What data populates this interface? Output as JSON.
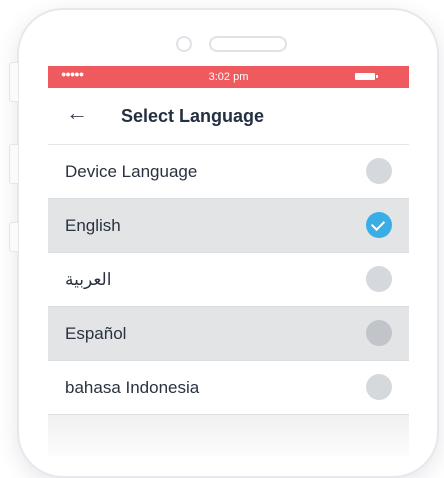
{
  "status_bar": {
    "signal": "●●●●●",
    "time": "3:02 pm"
  },
  "header": {
    "back_icon": "←",
    "title": "Select Language"
  },
  "languages": [
    {
      "label": "Device Language",
      "selected": false
    },
    {
      "label": "English",
      "selected": true
    },
    {
      "label": "العربية",
      "selected": false
    },
    {
      "label": "Español",
      "selected": false
    },
    {
      "label": "bahasa Indonesia",
      "selected": false
    }
  ],
  "colors": {
    "status_bar": "#ef5a5f",
    "selected_radio": "#39aee6"
  }
}
